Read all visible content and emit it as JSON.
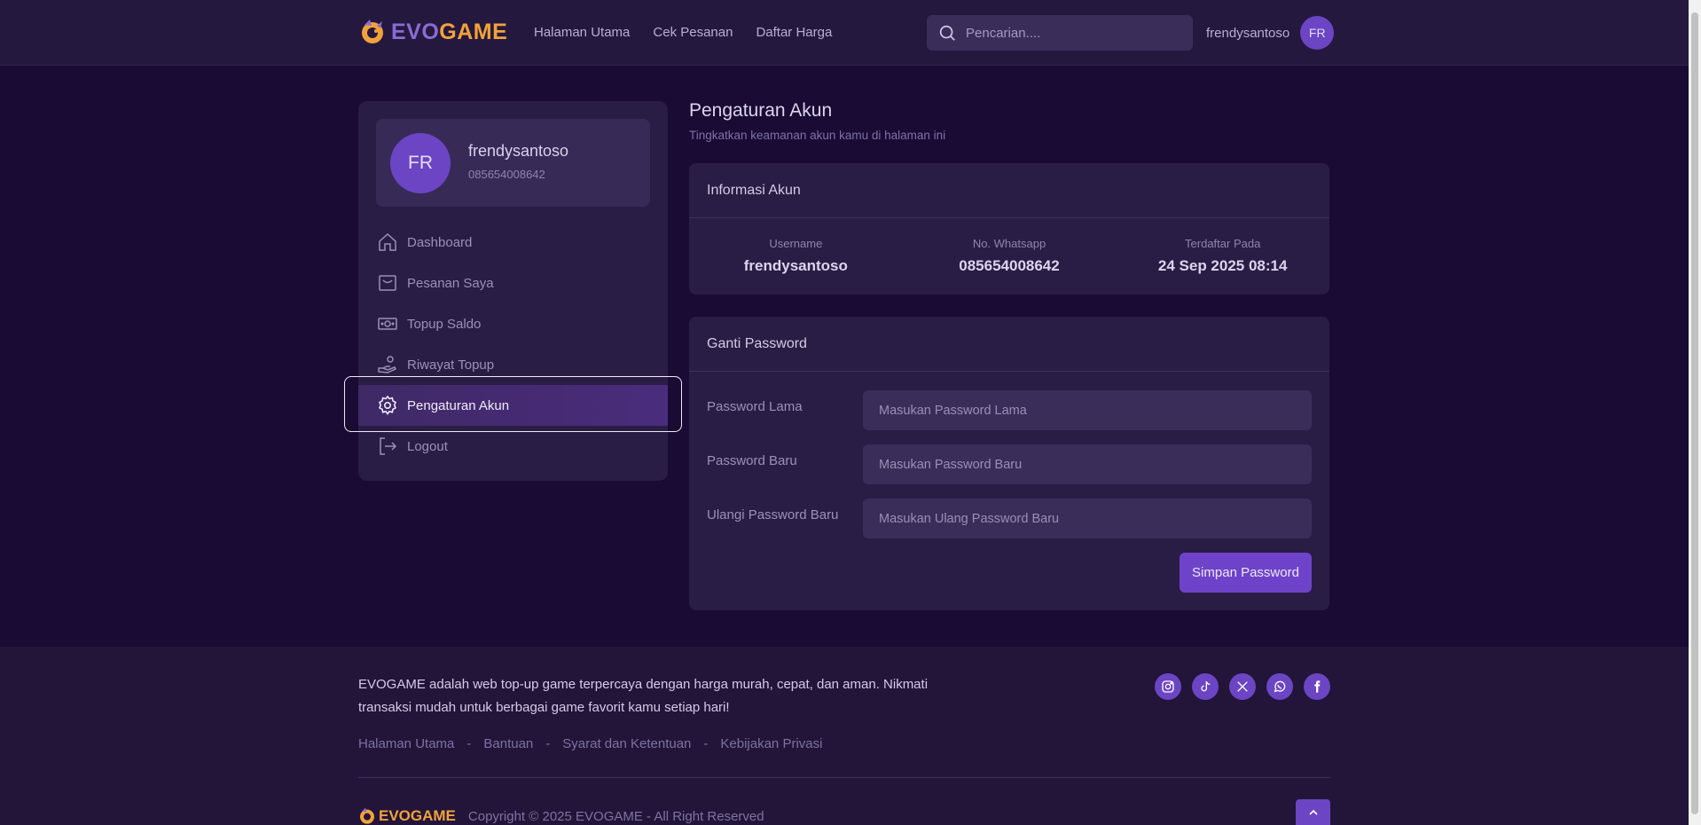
{
  "header": {
    "logo_text": "EVOGAME",
    "nav": [
      "Halaman Utama",
      "Cek Pesanan",
      "Daftar Harga"
    ],
    "search_placeholder": "Pencarian....",
    "username": "frendysantoso",
    "avatar_initials": "FR"
  },
  "sidebar": {
    "avatar_initials": "FR",
    "name": "frendysantoso",
    "phone": "085654008642",
    "menu": [
      {
        "label": "Dashboard",
        "icon": "home-icon"
      },
      {
        "label": "Pesanan Saya",
        "icon": "bag-icon"
      },
      {
        "label": "Topup Saldo",
        "icon": "money-icon"
      },
      {
        "label": "Riwayat Topup",
        "icon": "hand-coin-icon"
      },
      {
        "label": "Pengaturan Akun",
        "icon": "gear-icon",
        "active": true
      },
      {
        "label": "Logout",
        "icon": "logout-icon"
      }
    ]
  },
  "page": {
    "title": "Pengaturan Akun",
    "subtitle": "Tingkatkan keamanan akun kamu di halaman ini"
  },
  "account_info": {
    "title": "Informasi Akun",
    "username_label": "Username",
    "username_value": "frendysantoso",
    "whatsapp_label": "No. Whatsapp",
    "whatsapp_value": "085654008642",
    "registered_label": "Terdaftar Pada",
    "registered_value": "24 Sep 2025 08:14"
  },
  "password_form": {
    "title": "Ganti Password",
    "old_label": "Password Lama",
    "old_placeholder": "Masukan Password Lama",
    "new_label": "Password Baru",
    "new_placeholder": "Masukan Password Baru",
    "repeat_label": "Ulangi Password Baru",
    "repeat_placeholder": "Masukan Ulang Password Baru",
    "submit_label": "Simpan Password"
  },
  "footer": {
    "description": "EVOGAME adalah web top-up game terpercaya dengan harga murah, cepat, dan aman. Nikmati transaksi mudah untuk berbagai game favorit kamu setiap hari!",
    "links": [
      "Halaman Utama",
      "Bantuan",
      "Syarat dan Ketentuan",
      "Kebijakan Privasi"
    ],
    "separator": "-",
    "socials": [
      "instagram-icon",
      "tiktok-icon",
      "x-icon",
      "whatsapp-icon",
      "facebook-icon"
    ],
    "logo_text": "EVOGAME",
    "copyright": "Copyright © 2025 EVOGAME - All Right Reserved"
  },
  "colors": {
    "background": "#190b34",
    "panel": "#2a1d45",
    "accent": "#6b45c4",
    "logo_orange": "#f0a33a"
  }
}
